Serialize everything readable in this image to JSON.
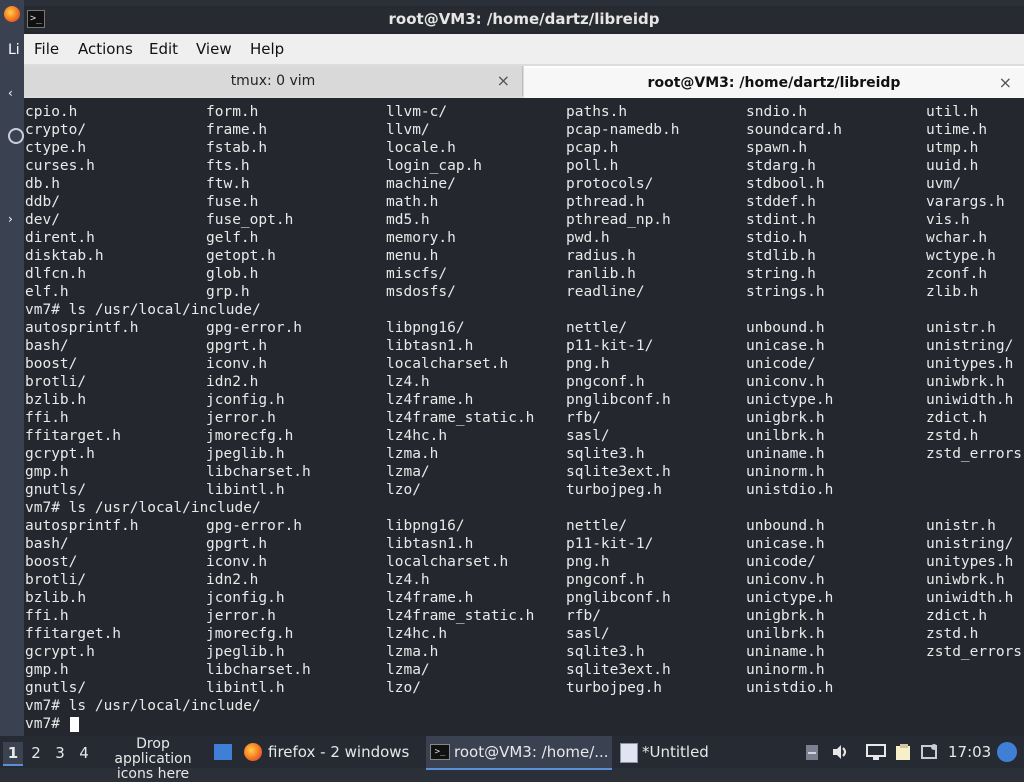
{
  "window": {
    "title": "root@VM3: /home/dartz/libreidp"
  },
  "menu": [
    "File",
    "Actions",
    "Edit",
    "View",
    "Help"
  ],
  "tabs": [
    {
      "label": "tmux: 0 vim",
      "close": "×"
    },
    {
      "label": "root@VM3: /home/dartz/libreidp",
      "close": "×"
    }
  ],
  "terminal": {
    "rows1": [
      [
        "cpio.h",
        "form.h",
        "llvm-c/",
        "paths.h",
        "sndio.h",
        "util.h"
      ],
      [
        "crypto/",
        "frame.h",
        "llvm/",
        "pcap-namedb.h",
        "soundcard.h",
        "utime.h"
      ],
      [
        "ctype.h",
        "fstab.h",
        "locale.h",
        "pcap.h",
        "spawn.h",
        "utmp.h"
      ],
      [
        "curses.h",
        "fts.h",
        "login_cap.h",
        "poll.h",
        "stdarg.h",
        "uuid.h"
      ],
      [
        "db.h",
        "ftw.h",
        "machine/",
        "protocols/",
        "stdbool.h",
        "uvm/"
      ],
      [
        "ddb/",
        "fuse.h",
        "math.h",
        "pthread.h",
        "stddef.h",
        "varargs.h"
      ],
      [
        "dev/",
        "fuse_opt.h",
        "md5.h",
        "pthread_np.h",
        "stdint.h",
        "vis.h"
      ],
      [
        "dirent.h",
        "gelf.h",
        "memory.h",
        "pwd.h",
        "stdio.h",
        "wchar.h"
      ],
      [
        "disktab.h",
        "getopt.h",
        "menu.h",
        "radius.h",
        "stdlib.h",
        "wctype.h"
      ],
      [
        "dlfcn.h",
        "glob.h",
        "miscfs/",
        "ranlib.h",
        "string.h",
        "zconf.h"
      ],
      [
        "elf.h",
        "grp.h",
        "msdosfs/",
        "readline/",
        "strings.h",
        "zlib.h"
      ]
    ],
    "cmd1": "vm7# ls /usr/local/include/",
    "rows2": [
      [
        "autosprintf.h",
        "gpg-error.h",
        "libpng16/",
        "nettle/",
        "unbound.h",
        "unistr.h"
      ],
      [
        "bash/",
        "gpgrt.h",
        "libtasn1.h",
        "p11-kit-1/",
        "unicase.h",
        "unistring/"
      ],
      [
        "boost/",
        "iconv.h",
        "localcharset.h",
        "png.h",
        "unicode/",
        "unitypes.h"
      ],
      [
        "brotli/",
        "idn2.h",
        "lz4.h",
        "pngconf.h",
        "uniconv.h",
        "uniwbrk.h"
      ],
      [
        "bzlib.h",
        "jconfig.h",
        "lz4frame.h",
        "pnglibconf.h",
        "unictype.h",
        "uniwidth.h"
      ],
      [
        "ffi.h",
        "jerror.h",
        "lz4frame_static.h",
        "rfb/",
        "unigbrk.h",
        "zdict.h"
      ],
      [
        "ffitarget.h",
        "jmorecfg.h",
        "lz4hc.h",
        "sasl/",
        "unilbrk.h",
        "zstd.h"
      ],
      [
        "gcrypt.h",
        "jpeglib.h",
        "lzma.h",
        "sqlite3.h",
        "uniname.h",
        "zstd_errors.h"
      ],
      [
        "gmp.h",
        "libcharset.h",
        "lzma/",
        "sqlite3ext.h",
        "uninorm.h",
        ""
      ],
      [
        "gnutls/",
        "libintl.h",
        "lzo/",
        "turbojpeg.h",
        "unistdio.h",
        ""
      ]
    ],
    "cmd2": "vm7# ls /usr/local/include/",
    "rows3": [
      [
        "autosprintf.h",
        "gpg-error.h",
        "libpng16/",
        "nettle/",
        "unbound.h",
        "unistr.h"
      ],
      [
        "bash/",
        "gpgrt.h",
        "libtasn1.h",
        "p11-kit-1/",
        "unicase.h",
        "unistring/"
      ],
      [
        "boost/",
        "iconv.h",
        "localcharset.h",
        "png.h",
        "unicode/",
        "unitypes.h"
      ],
      [
        "brotli/",
        "idn2.h",
        "lz4.h",
        "pngconf.h",
        "uniconv.h",
        "uniwbrk.h"
      ],
      [
        "bzlib.h",
        "jconfig.h",
        "lz4frame.h",
        "pnglibconf.h",
        "unictype.h",
        "uniwidth.h"
      ],
      [
        "ffi.h",
        "jerror.h",
        "lz4frame_static.h",
        "rfb/",
        "unigbrk.h",
        "zdict.h"
      ],
      [
        "ffitarget.h",
        "jmorecfg.h",
        "lz4hc.h",
        "sasl/",
        "unilbrk.h",
        "zstd.h"
      ],
      [
        "gcrypt.h",
        "jpeglib.h",
        "lzma.h",
        "sqlite3.h",
        "uniname.h",
        "zstd_errors.h"
      ],
      [
        "gmp.h",
        "libcharset.h",
        "lzma/",
        "sqlite3ext.h",
        "uninorm.h",
        ""
      ],
      [
        "gnutls/",
        "libintl.h",
        "lzo/",
        "turbojpeg.h",
        "unistdio.h",
        ""
      ]
    ],
    "cmd3": "vm7# ls /usr/local/include/",
    "prompt": "vm7# "
  },
  "desktop": {
    "partial_label": "Li"
  },
  "taskbar": {
    "workspaces": [
      "1",
      "2",
      "3",
      "4"
    ],
    "drop_hint": "Drop application icons here",
    "tasks": [
      {
        "label": "firefox - 2 windows",
        "icon": "firefox-icon"
      },
      {
        "label": "root@VM3: /home/...",
        "icon": "terminal-icon"
      },
      {
        "label": "*Untitled",
        "icon": "text-editor-icon"
      }
    ],
    "clock": "17:03"
  },
  "colors": {
    "terminal_bg": "#24272e",
    "terminal_fg": "#e9e9e9",
    "taskbar_bg": "#252a33",
    "accent": "#3f7fd8"
  }
}
